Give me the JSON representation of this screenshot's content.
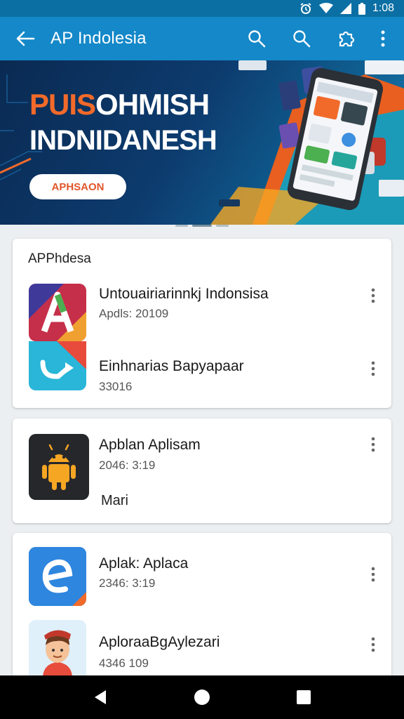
{
  "status_bar": {
    "time": "1:08"
  },
  "app_bar": {
    "title": "AP Indolesia",
    "icons": [
      "back-arrow-icon",
      "search-icon",
      "search-icon",
      "puzzle-icon",
      "more-vert-icon"
    ]
  },
  "banner": {
    "headline_accent": "PUIS",
    "headline_rest": "OHMISH",
    "headline_line2": "INDNIDANESH",
    "cta_label": "APHSAON"
  },
  "cards": [
    {
      "section_title": "APPhdesa",
      "apps": [
        {
          "name": "Untouairiarinnkj Indonsisa",
          "meta": "Apdls: 20109",
          "icon": "letter-a-logo-icon"
        },
        {
          "name": "Einhnarias Bapyapaar",
          "meta": "33016",
          "icon": "swoosh-logo-icon"
        }
      ]
    },
    {
      "apps": [
        {
          "name": "Apblan Aplisam",
          "meta": "2046: 3:19",
          "extra": "Mari",
          "icon": "android-robot-icon"
        }
      ]
    },
    {
      "apps": [
        {
          "name": "Aplak: Aplaca",
          "meta": "2346: 3:19",
          "icon": "letter-e-logo-icon"
        },
        {
          "name": "AploraaBgAylezari",
          "meta": "4346 109",
          "icon": "avatar-character-icon"
        }
      ]
    }
  ],
  "nav_bar": {
    "icons": [
      "nav-back-icon",
      "nav-home-icon",
      "nav-recents-icon"
    ]
  },
  "colors": {
    "app_bar": "#1488c8",
    "status_bar": "#0b6fa4",
    "banner_accent": "#f26a2a",
    "background": "#eceff1"
  }
}
